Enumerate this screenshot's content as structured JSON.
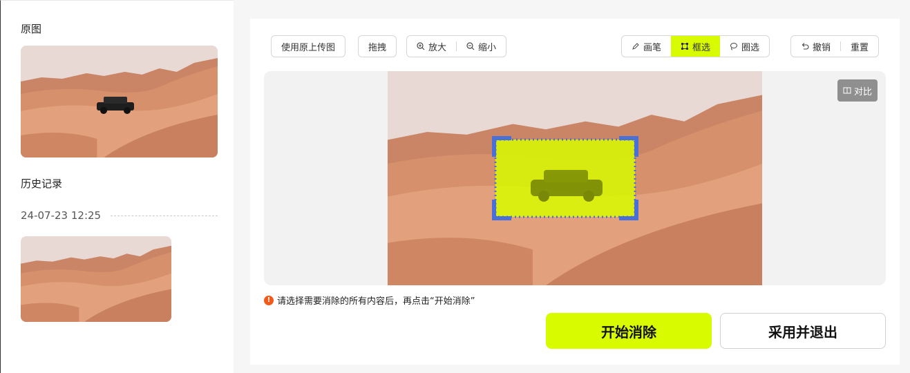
{
  "sidebar": {
    "original_title": "原图",
    "history_title": "历史记录",
    "history": [
      {
        "time": "24-07-23 12:25"
      }
    ]
  },
  "toolbar": {
    "use_original": "使用原上传图",
    "drag": "拖拽",
    "zoom_in": "放大",
    "zoom_out": "缩小",
    "brush": "画笔",
    "box_select": "框选",
    "lasso": "圈选",
    "undo": "撤销",
    "reset": "重置",
    "active_tool": "box_select"
  },
  "canvas": {
    "compare_label": "对比"
  },
  "hint": "请选择需要消除的所有内容后，再点击“开始消除”",
  "actions": {
    "start": "开始消除",
    "adopt": "采用并退出"
  },
  "colors": {
    "accent": "#d8fb00",
    "selection_handle": "#4a6fd6",
    "warning": "#f25a1c"
  }
}
